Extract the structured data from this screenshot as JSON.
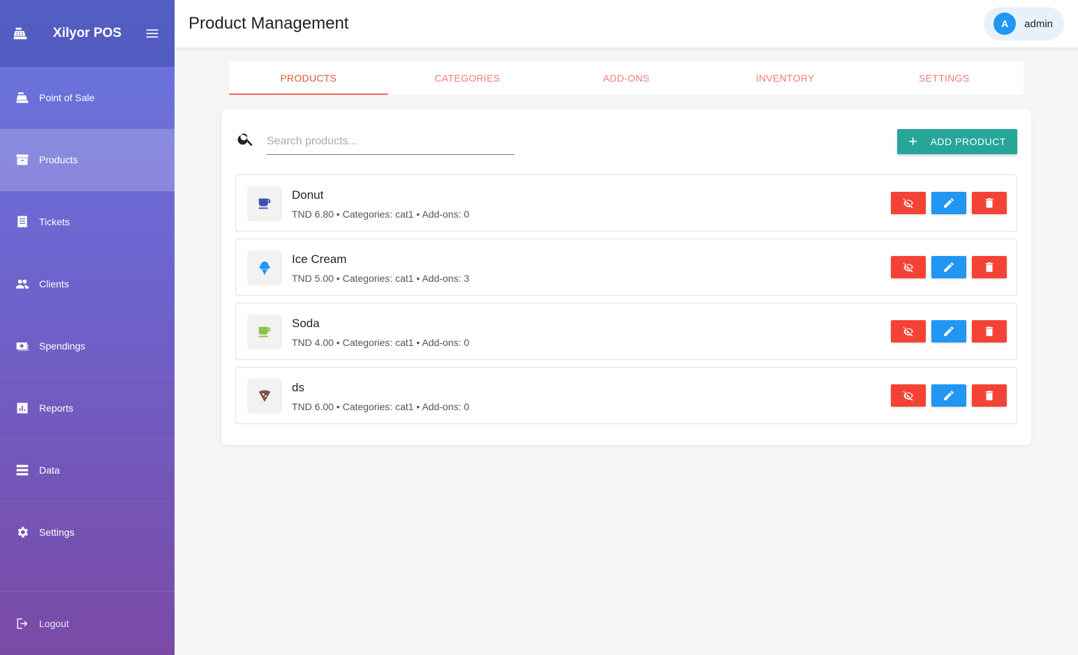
{
  "app": {
    "title": "Xilyor POS"
  },
  "sidebar": {
    "items": [
      {
        "label": "Point of Sale",
        "icon": "cash-register-icon",
        "active": false
      },
      {
        "label": "Products",
        "icon": "archive-box-icon",
        "active": true
      },
      {
        "label": "Tickets",
        "icon": "receipt-icon",
        "active": false
      },
      {
        "label": "Clients",
        "icon": "people-icon",
        "active": false
      },
      {
        "label": "Spendings",
        "icon": "money-icon",
        "active": false
      },
      {
        "label": "Reports",
        "icon": "bar-chart-icon",
        "active": false
      },
      {
        "label": "Data",
        "icon": "storage-icon",
        "active": false
      },
      {
        "label": "Settings",
        "icon": "gear-icon",
        "active": false
      }
    ],
    "logout_label": "Logout"
  },
  "header": {
    "title": "Product Management",
    "user": {
      "initial": "A",
      "name": "admin"
    }
  },
  "tabs": [
    {
      "label": "PRODUCTS",
      "active": true
    },
    {
      "label": "CATEGORIES",
      "active": false
    },
    {
      "label": "ADD-ONS",
      "active": false
    },
    {
      "label": "INVENTORY",
      "active": false
    },
    {
      "label": "SETTINGS",
      "active": false
    }
  ],
  "search": {
    "placeholder": "Search products...",
    "value": ""
  },
  "add_button": {
    "label": "ADD PRODUCT"
  },
  "products": [
    {
      "name": "Donut",
      "meta": "TND 6.80 • Categories: cat1 • Add-ons: 0",
      "icon": "coffee-cup-icon",
      "icon_color": "#3f51b5"
    },
    {
      "name": "Ice Cream",
      "meta": "TND 5.00 • Categories: cat1 • Add-ons: 3",
      "icon": "ice-cream-icon",
      "icon_color": "#2196f3"
    },
    {
      "name": "Soda",
      "meta": "TND 4.00 • Categories: cat1 • Add-ons: 0",
      "icon": "coffee-cup-icon",
      "icon_color": "#8bc34a"
    },
    {
      "name": "ds",
      "meta": "TND 6.00 • Categories: cat1 • Add-ons: 0",
      "icon": "pizza-slice-icon",
      "icon_color": "#795548"
    }
  ],
  "colors": {
    "accent": "#26a69a",
    "tab_active": "#e5533f",
    "danger": "#f44336",
    "primary": "#2196f3"
  }
}
